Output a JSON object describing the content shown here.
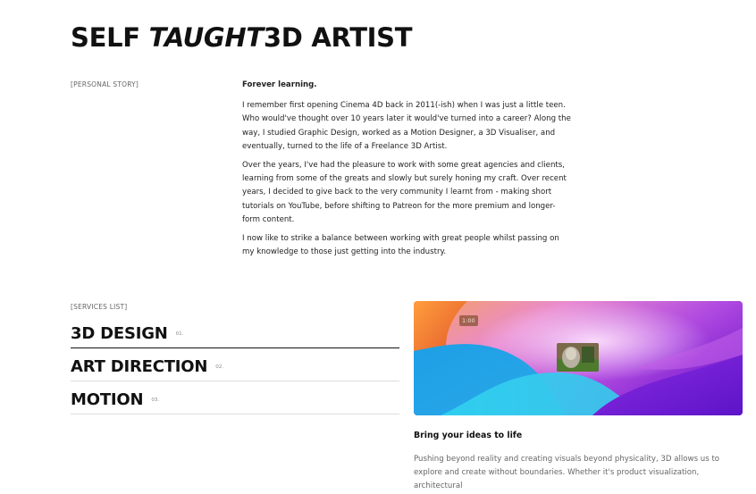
{
  "hero": {
    "title_part1": "SELF",
    "title_part2": "TAUGHT",
    "title_part3": "3D ARTIST"
  },
  "story": {
    "label": "[PERSONAL STORY]",
    "lead": "Forever learning.",
    "paragraphs": [
      "I remember first opening Cinema 4D back in 2011(-ish) when I was just a little teen. Who would've thought over 10 years later it would've turned into a career? Along the way, I studied Graphic Design, worked as a Motion Designer, a 3D Visualiser, and eventually, turned to the life of a Freelance 3D Artist.",
      "Over the years, I've had the pleasure to work with some great agencies and clients, learning from some of the greats and slowly but surely honing my craft. Over recent years, I decided to give back to the very community I learnt from - making short tutorials on YouTube, before shifting to Patreon for the more premium and longer-form content.",
      "I now like to strike a balance between working with great people whilst passing on my knowledge to those just getting into the industry."
    ]
  },
  "services": {
    "label": "[SERVICES LIST]",
    "items": [
      {
        "name": "3D DESIGN",
        "num": "01."
      },
      {
        "name": "ART DIRECTION",
        "num": "02."
      },
      {
        "name": "MOTION",
        "num": "03."
      }
    ]
  },
  "media": {
    "time": "1:00",
    "caption_title": "Bring your ideas to life",
    "caption_body": "Pushing beyond reality and creating visuals beyond physicality, 3D allows us to explore and create without boundaries. Whether it's product visualization, architectural"
  },
  "colors": {
    "accent_purple": "#8a2be2",
    "accent_orange": "#f28a3c",
    "accent_blue": "#1fa3e0"
  }
}
